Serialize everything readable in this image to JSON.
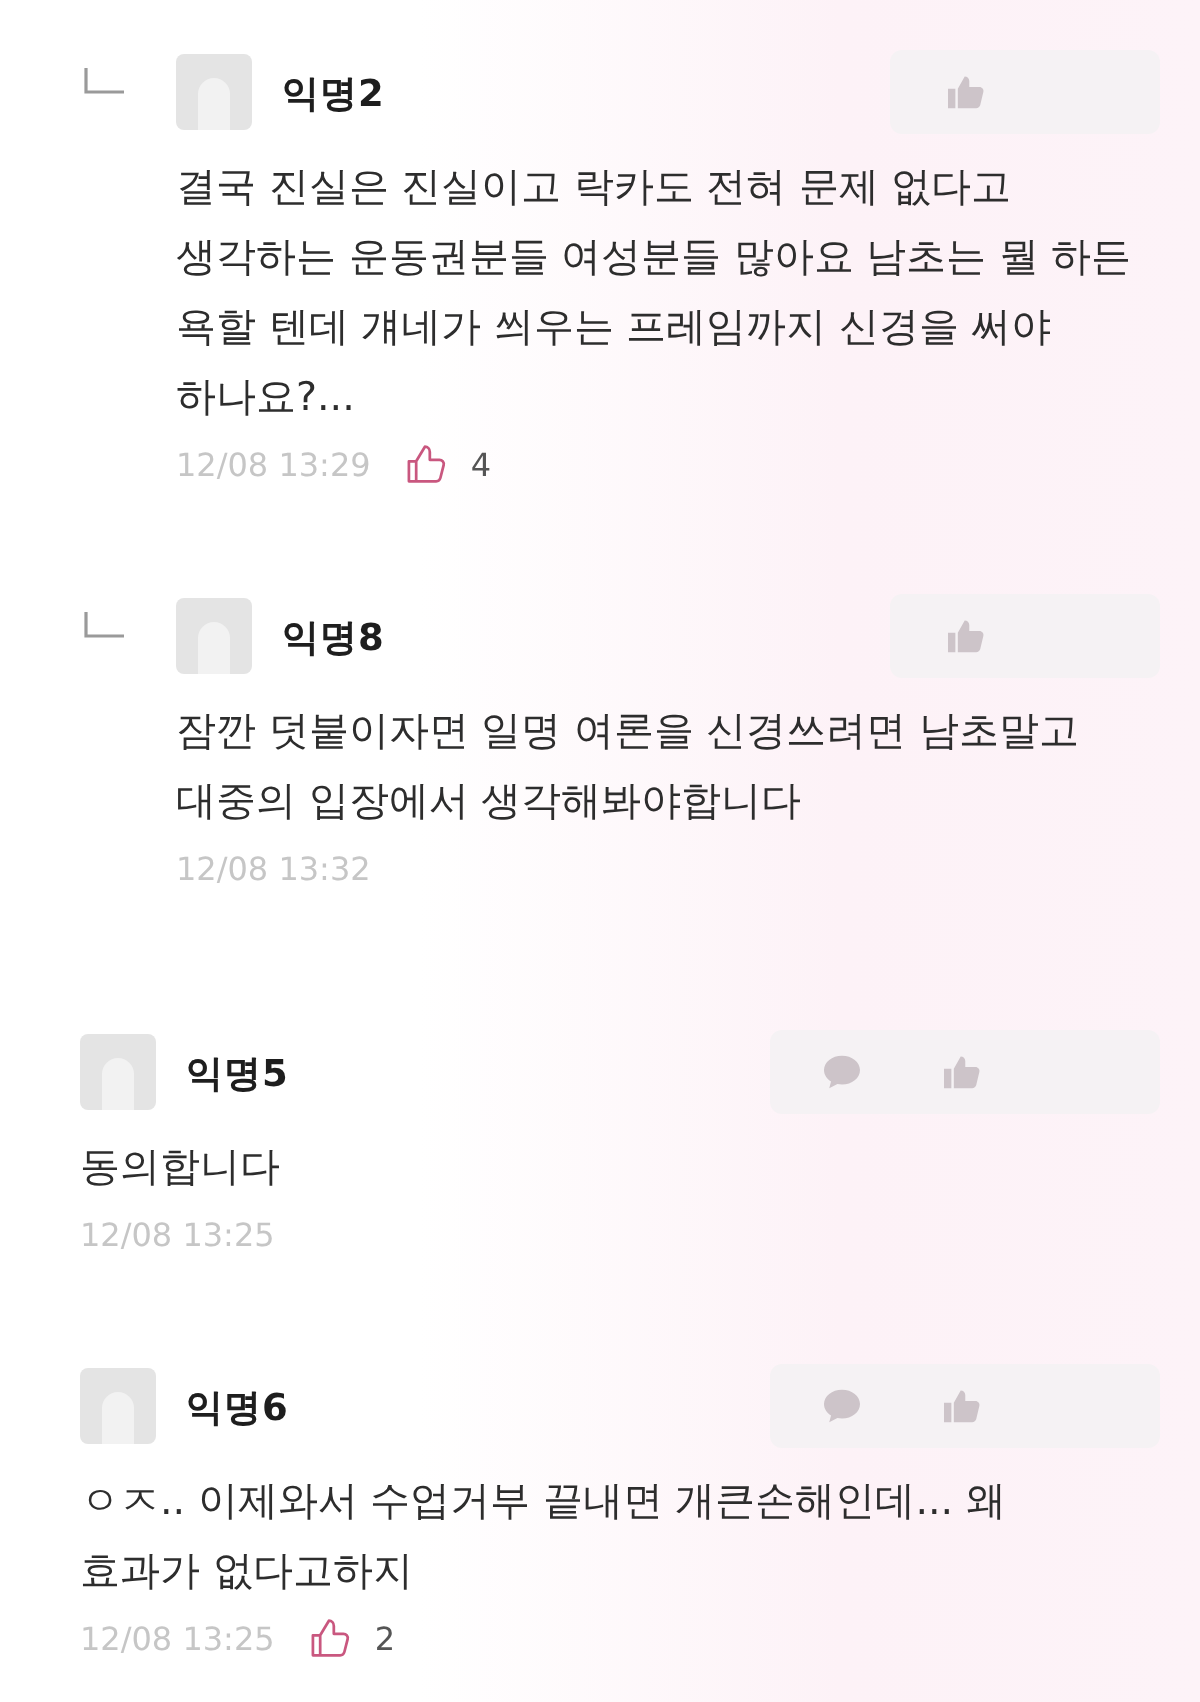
{
  "comments": [
    {
      "kind": "reply",
      "author": "익명2",
      "text": "결국 진실은 진실이고 락카도 전혀 문제 없다고\n생각하는 운동권분들 여성분들 많아요 남초는 뭘 하든\n욕할 텐데 걔네가 씌우는 프레임까지 신경을 써야\n하나요?...",
      "time": "12/08 13:29",
      "likes": "4"
    },
    {
      "kind": "reply",
      "author": "익명8",
      "text": "잠깐 덧붙이자면 일명 여론을 신경쓰려면 남초말고\n대중의 입장에서 생각해봐야합니다",
      "time": "12/08 13:32"
    },
    {
      "kind": "comment",
      "author": "익명5",
      "text": "동의합니다",
      "time": "12/08 13:25"
    },
    {
      "kind": "comment",
      "author": "익명6",
      "text": "ㅇㅈ.. 이제와서 수업거부 끝내면 개큰손해인데... 왜\n효과가 없다고하지",
      "time": "12/08 13:25",
      "likes": "2"
    }
  ]
}
